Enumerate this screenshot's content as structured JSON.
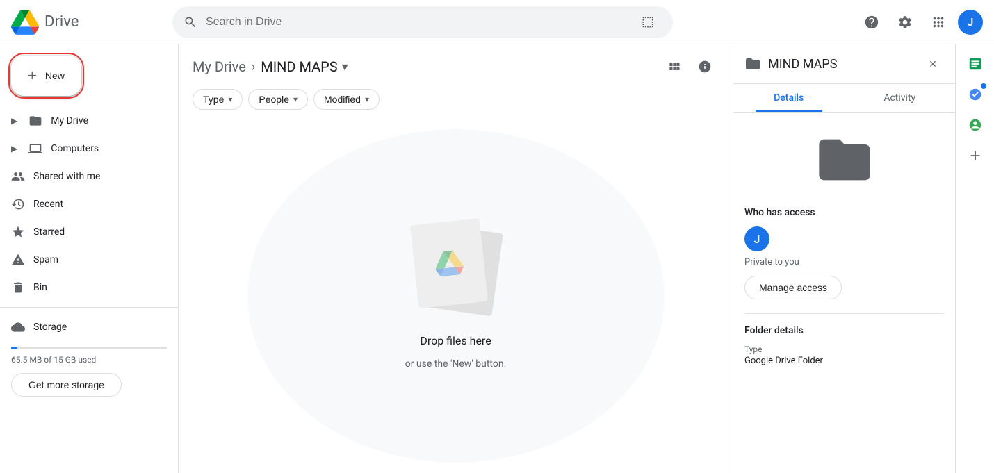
{
  "app": {
    "name": "Drive",
    "logo_alt": "Google Drive logo"
  },
  "topbar": {
    "search_placeholder": "Search in Drive",
    "help_icon": "?",
    "settings_icon": "⚙",
    "apps_icon": "⊞",
    "avatar_initial": "J"
  },
  "sidebar": {
    "new_label": "New",
    "items": [
      {
        "id": "my-drive",
        "label": "My Drive",
        "icon": "folder",
        "expandable": true,
        "active": false
      },
      {
        "id": "computers",
        "label": "Computers",
        "icon": "computer",
        "expandable": true,
        "active": false
      },
      {
        "id": "shared-with-me",
        "label": "Shared with me",
        "icon": "people",
        "active": false
      },
      {
        "id": "recent",
        "label": "Recent",
        "icon": "clock",
        "active": false
      },
      {
        "id": "starred",
        "label": "Starred",
        "icon": "star",
        "active": false
      },
      {
        "id": "spam",
        "label": "Spam",
        "icon": "warning",
        "active": false
      },
      {
        "id": "bin",
        "label": "Bin",
        "icon": "trash",
        "active": false
      },
      {
        "id": "storage",
        "label": "Storage",
        "icon": "cloud",
        "active": false
      }
    ],
    "storage_used": "65.5 MB of 15 GB used",
    "storage_percent": 0.44,
    "get_storage_label": "Get more storage"
  },
  "content": {
    "breadcrumb": {
      "root": "My Drive",
      "current": "MIND MAPS"
    },
    "filters": [
      {
        "id": "type",
        "label": "Type"
      },
      {
        "id": "people",
        "label": "People"
      },
      {
        "id": "modified",
        "label": "Modified"
      }
    ],
    "drop_zone": {
      "title": "Drop files here",
      "subtitle": "or use the 'New' button."
    }
  },
  "right_panel": {
    "folder_name": "MIND MAPS",
    "close_icon": "×",
    "tabs": [
      {
        "id": "details",
        "label": "Details",
        "active": true
      },
      {
        "id": "activity",
        "label": "Activity",
        "active": false
      }
    ],
    "who_has_access": {
      "title": "Who has access",
      "user_initial": "J",
      "private_label": "Private to you"
    },
    "manage_access_label": "Manage access",
    "folder_details": {
      "title": "Folder details",
      "type_label": "Type",
      "type_value": "Google Drive Folder"
    },
    "expand_icon": "›"
  }
}
